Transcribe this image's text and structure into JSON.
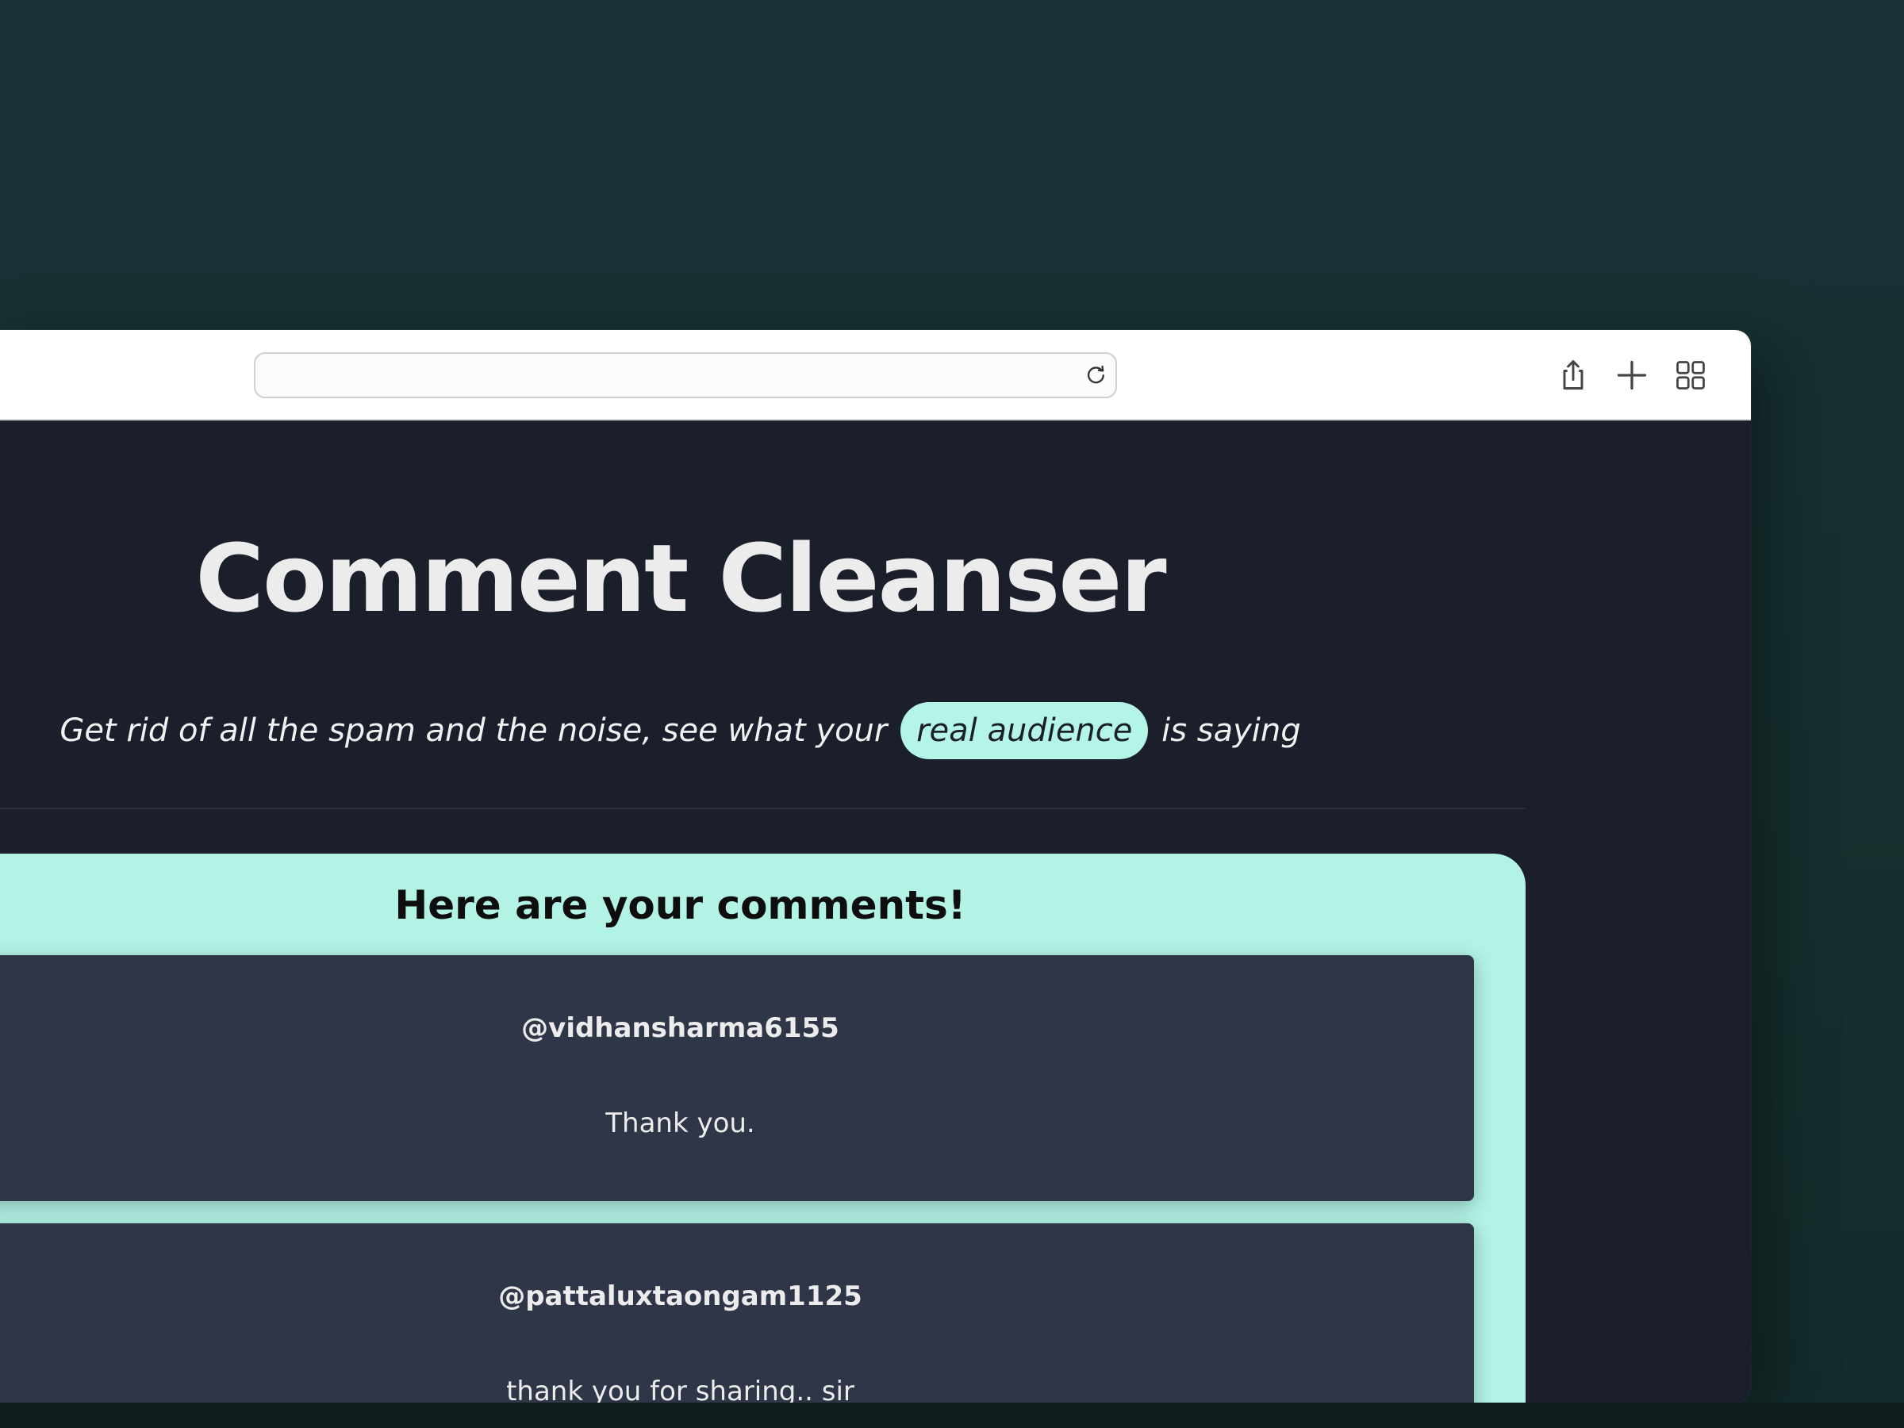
{
  "app": {
    "title": "Comment Cleanser",
    "subtitle_before": "Get rid of all the spam and the noise, see what your",
    "subtitle_highlight": "real audience",
    "subtitle_after": "is saying"
  },
  "browser": {
    "address_value": "",
    "icons": {
      "reload": "reload-icon",
      "share": "share-icon",
      "new_tab": "plus-icon",
      "tab_overview": "tab-grid-icon"
    }
  },
  "comments": {
    "heading": "Here are your comments!",
    "items": [
      {
        "author": "@vidhansharma6155",
        "text": "Thank you."
      },
      {
        "author": "@pattaluxtaongam1125",
        "text": "thank you for sharing.. sir"
      }
    ]
  },
  "colors": {
    "background": "#173136",
    "page": "#1b1f2b",
    "accent": "#b2f3e6",
    "card": "#2e3648",
    "text": "#ececec"
  }
}
